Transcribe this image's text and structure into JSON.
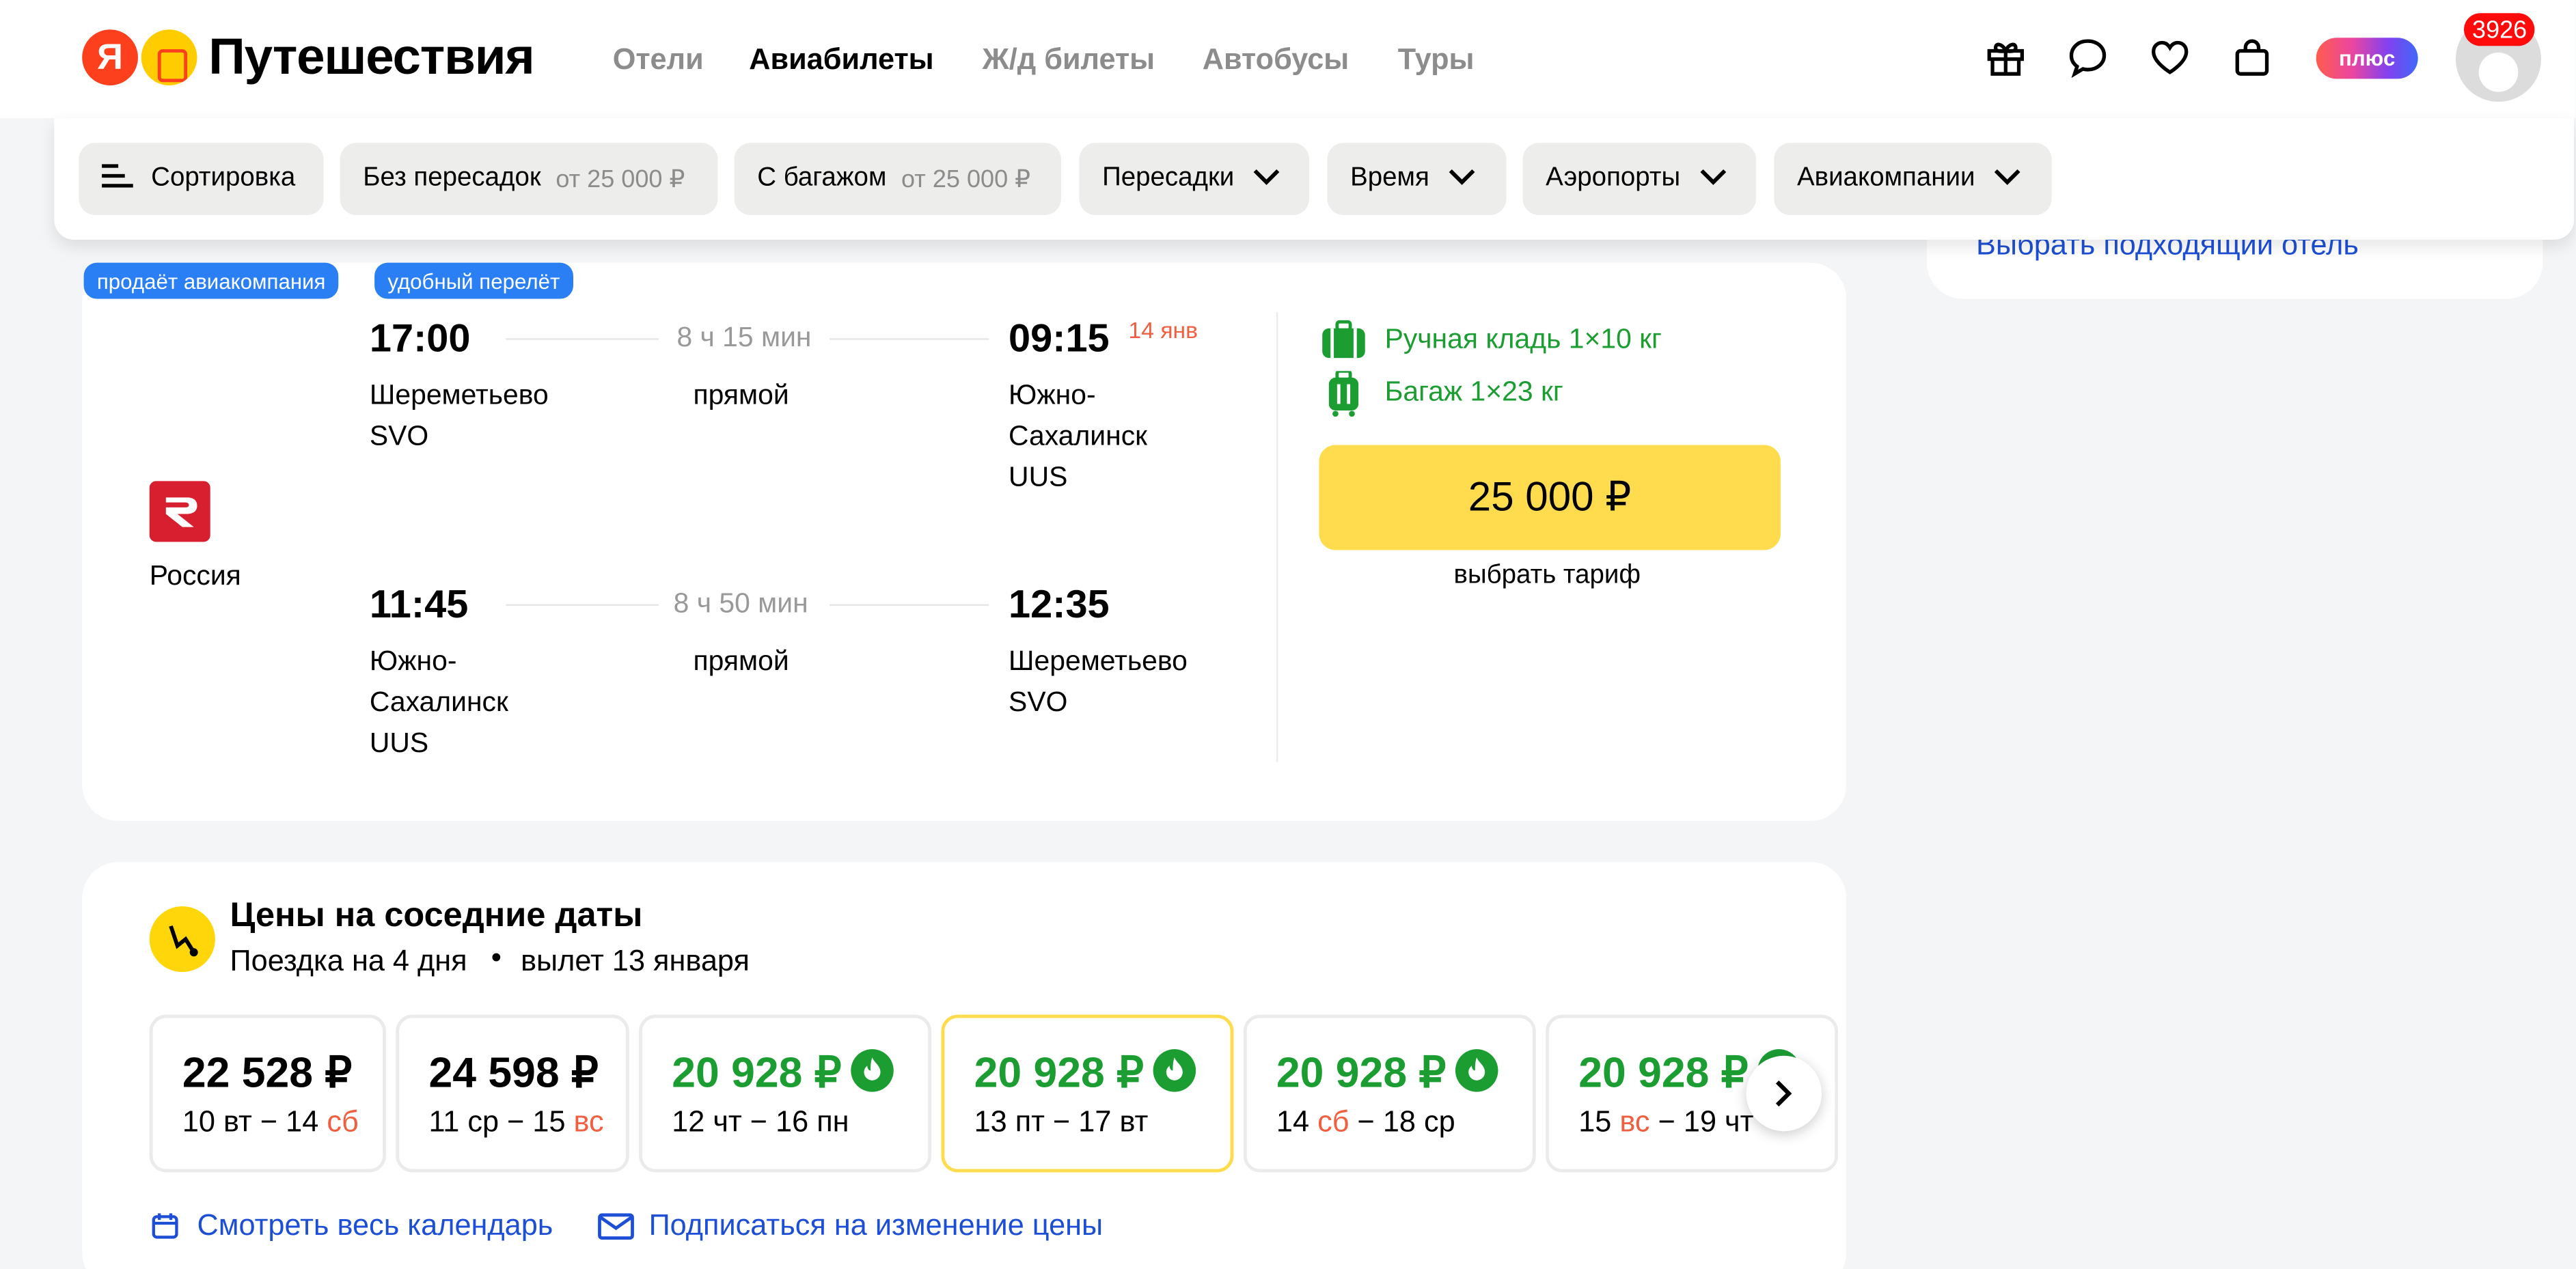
{
  "header": {
    "logo_text": "Путешествия",
    "logo_letter": "Я",
    "nav": [
      "Отели",
      "Авиабилеты",
      "Ж/д билеты",
      "Автобусы",
      "Туры"
    ],
    "plus_label": "плюс",
    "notifications_count": "3926"
  },
  "filters": {
    "sort_label": "Сортировка",
    "nonstop_label": "Без пересадок",
    "nonstop_price": "от 25 000 ₽",
    "baggage_label": "С багажом",
    "baggage_price": "от 25 000 ₽",
    "transfers_label": "Пересадки",
    "time_label": "Время",
    "airports_label": "Аэропорты",
    "airlines_label": "Авиакомпании"
  },
  "sidebar": {
    "hotel_link": "Выбрать подходящий отель"
  },
  "offer": {
    "tags": [
      "продаёт авиакомпания",
      "удобный перелёт"
    ],
    "airline": "Россия",
    "outbound": {
      "dep_time": "17:00",
      "dep_city": "Шереметьево",
      "dep_code": "SVO",
      "duration": "8 ч 15 мин",
      "type": "прямой",
      "arr_time": "09:15",
      "arr_date": "14 янв",
      "arr_city_1": "Южно-",
      "arr_city_2": "Сахалинск",
      "arr_code": "UUS"
    },
    "return": {
      "dep_time": "11:45",
      "dep_city_1": "Южно-",
      "dep_city_2": "Сахалинск",
      "dep_code": "UUS",
      "duration": "8 ч 50 мин",
      "type": "прямой",
      "arr_time": "12:35",
      "arr_city": "Шереметьево",
      "arr_code": "SVO"
    },
    "hand_luggage": "Ручная кладь 1×10 кг",
    "baggage": "Багаж 1×23 кг",
    "price": "25 000 ₽",
    "choose_fare": "выбрать тариф"
  },
  "nearby": {
    "title": "Цены на соседние даты",
    "trip": "Поездка на 4 дня",
    "departure": "вылет 13 января",
    "cards": [
      {
        "price": "22 528 ₽",
        "d1": "10 вт − 14 ",
        "d2": "сб",
        "d3": ""
      },
      {
        "price": "24 598 ₽",
        "d1": "11 ср − 15 ",
        "d2": "вс",
        "d3": ""
      },
      {
        "price": "20 928 ₽",
        "d1": "12 чт − 16 пн",
        "d2": "",
        "d3": ""
      },
      {
        "price": "20 928 ₽",
        "d1": "13 пт − 17 вт",
        "d2": "",
        "d3": ""
      },
      {
        "price": "20 928 ₽",
        "d1": "14 ",
        "d2": "сб",
        "d3": " − 18 ср"
      },
      {
        "price": "20 928 ₽",
        "d1": "15 ",
        "d2": "вс",
        "d3": " − 19 чт"
      }
    ],
    "calendar_link": "Смотреть весь календарь",
    "subscribe_link": "Подписаться на изменение цены"
  },
  "colors": {
    "accent_yellow": "#ffdc4e",
    "price_green": "#1b9d32",
    "link_blue": "#1d4fd6",
    "tag_blue": "#2a7ff4",
    "weekend_red": "#f05f40",
    "airline_red": "#d71f2f"
  },
  "icons": [
    "gift-icon",
    "chat-icon",
    "heart-icon",
    "bag-icon",
    "hand-luggage-icon",
    "suitcase-icon",
    "flame-icon",
    "calendar-icon",
    "mail-icon",
    "chevron-right-icon",
    "sort-icon",
    "chevron-down-icon"
  ]
}
